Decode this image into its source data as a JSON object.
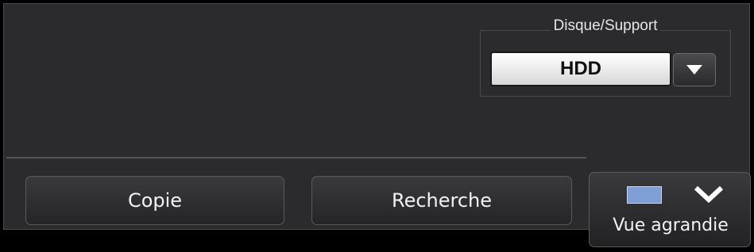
{
  "media": {
    "label": "Disque/Support",
    "selected": "HDD",
    "dropdown_icon": "triangle-down-icon"
  },
  "buttons": {
    "copy_label": "Copie",
    "search_label": "Recherche"
  },
  "view": {
    "label": "Vue agrandie",
    "screen_icon": "screen-rect-icon",
    "chevron_icon": "chevron-down-icon",
    "screen_color": "#7f9ed6"
  }
}
